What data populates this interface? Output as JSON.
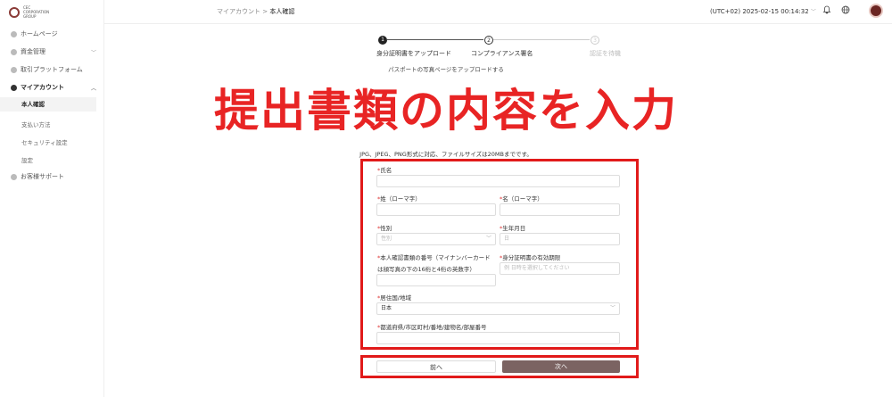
{
  "logo": {
    "text_line1": "CEC",
    "text_line2": "CORPORATION",
    "text_line3": "GROUP"
  },
  "sidebar": {
    "home": "ホームページ",
    "funds": "資金管理",
    "platform": "取引プラットフォーム",
    "account": "マイアカウント",
    "sub": [
      "本人確認",
      "支払い方法",
      "セキュリティ設定",
      "設定"
    ],
    "support": "お客様サポート"
  },
  "header": {
    "breadcrumb_parent": "マイアカウント",
    "breadcrumb_sep": ">",
    "breadcrumb_current": "本人確認",
    "timezone": "(UTC+02)  2025-02-15 00:14:32"
  },
  "steps": [
    {
      "num": "1",
      "label": "身分証明書をアップロード"
    },
    {
      "num": "2",
      "label": "コンプライアンス署名"
    },
    {
      "num": "3",
      "label": "認証を待機"
    }
  ],
  "hint": "パスポートの写真ページをアップロードする",
  "overlay": "提出書類の内容を入力",
  "file_hint": "JPG、JPEG、PNG形式に対応、ファイルサイズは20MBまでです。",
  "form": {
    "name_label": "氏名",
    "last_name_label": "姓（ローマ字）",
    "first_name_label": "名（ローマ字）",
    "gender_label": "性別",
    "gender_placeholder": "性別",
    "birth_label": "生年月日",
    "birth_placeholder": "日",
    "id_number_label_1": "本人確認書類の番号（マイナンバーカード",
    "id_number_label_2": "は顔写真の下の16桁と4桁の英数字）",
    "expiry_label": "身分証明書の有効期限",
    "expiry_placeholder": "例 日時を選択してください",
    "country_label": "居住国/地域",
    "country_value": "日本",
    "address_label": "都道府県/市区町村/番地/建物名/部屋番号"
  },
  "buttons": {
    "prev": "前へ",
    "next": "次へ"
  },
  "colors": {
    "overlay": "#e82424",
    "box": "#e11a1a",
    "next_button": "#7b6362",
    "brand": "#8a3b37"
  }
}
